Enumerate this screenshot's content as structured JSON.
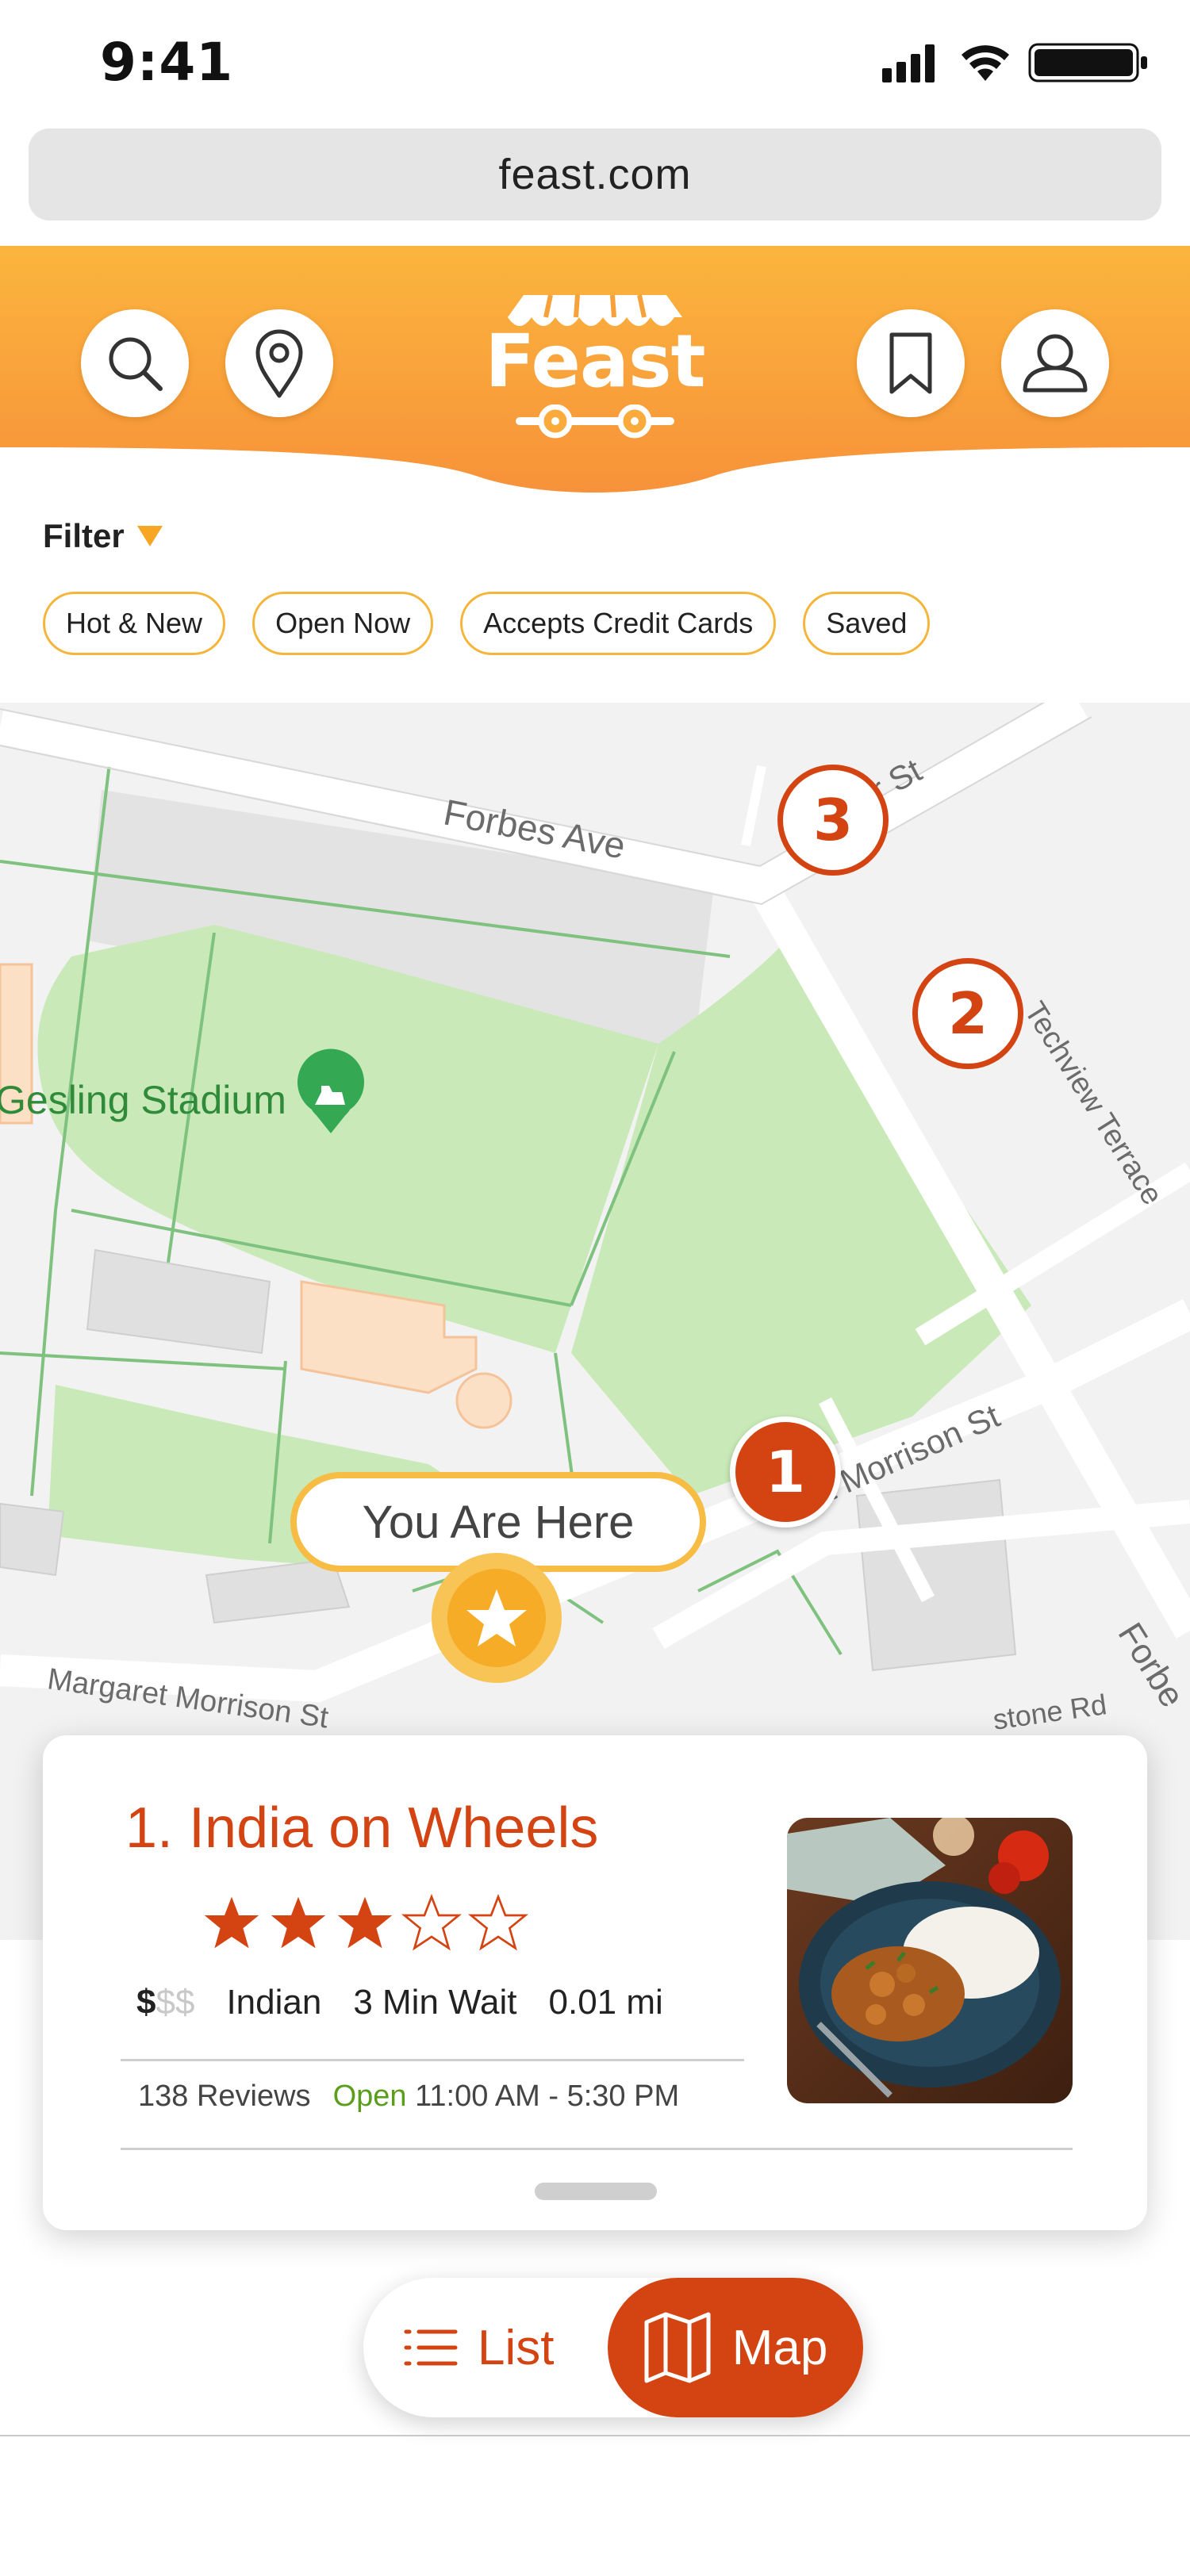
{
  "status_bar": {
    "time": "9:41",
    "icons": [
      "signal-icon",
      "wifi-icon",
      "battery-icon"
    ]
  },
  "browser": {
    "url": "feast.com"
  },
  "header": {
    "logo_text": "Feast",
    "buttons": [
      "search-icon",
      "location-pin-icon",
      "bookmark-icon",
      "profile-icon"
    ],
    "colors": {
      "gradient_top": "#fbb53d",
      "gradient_bottom": "#f7923a"
    }
  },
  "filter": {
    "label": "Filter",
    "chips": [
      "Hot & New",
      "Open Now",
      "Accepts Credit Cards",
      "Saved"
    ]
  },
  "map": {
    "place_label": "Gesling Stadium",
    "streets": {
      "forbes_ave": "Forbes Ave",
      "schenley": "er St",
      "techview": "Techview Terrace",
      "morrison": "t Morrison St",
      "margaret": "Margaret Morrison St",
      "tone": "stone Rd",
      "forbes_right": "Forbe"
    },
    "pins": [
      "1",
      "2",
      "3"
    ],
    "you_are_here": "You Are Here"
  },
  "card": {
    "title": "1. India on Wheels",
    "rating": 3,
    "rating_max": 5,
    "price_on": "$",
    "price_off": "$$",
    "cuisine": "Indian",
    "wait": "3 Min Wait",
    "distance": "0.01 mi",
    "reviews": "138 Reviews",
    "status": "Open",
    "hours": "11:00 AM - 5:30 PM",
    "image": "curry-with-rice-plate"
  },
  "view_toggle": {
    "list_label": "List",
    "map_label": "Map",
    "active": "Map"
  },
  "colors": {
    "accent": "#d44413",
    "chip_border": "#f5b53a",
    "open_green": "#5a9e1c"
  }
}
